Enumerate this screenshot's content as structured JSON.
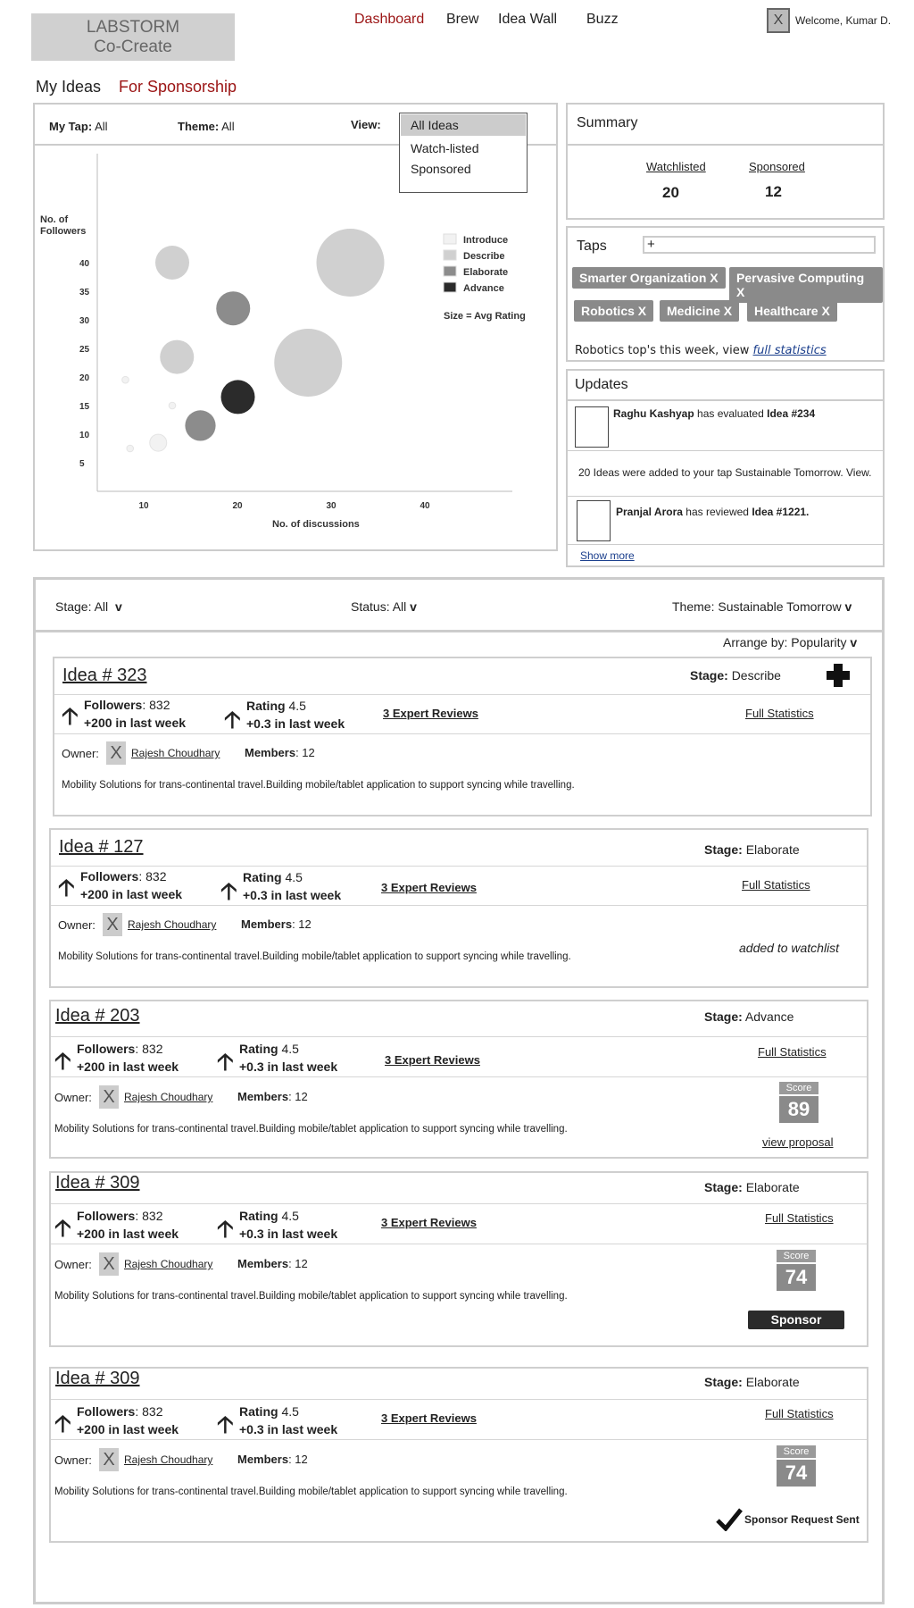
{
  "header": {
    "logo_line1": "LABSTORM",
    "logo_line2": "Co-Create",
    "nav": [
      "Dashboard",
      "Brew",
      "Idea Wall",
      "Buzz"
    ],
    "welcome": "Welcome, Kumar D.",
    "avatar_glyph": "X"
  },
  "tabs": {
    "my_ideas": "My Ideas",
    "for_sponsorship": "For Sponsorship"
  },
  "filters": {
    "my_tap_label": "My Tap:",
    "my_tap_value": "All",
    "theme_label": "Theme:",
    "theme_value": "All",
    "view_label": "View:",
    "view_options": [
      "All Ideas",
      "Watch-listed",
      "Sponsored"
    ]
  },
  "chart_data": {
    "type": "scatter",
    "ylabel": "No. of Followers",
    "xlabel": "No. of discussions",
    "x_ticks": [
      10,
      20,
      30,
      40
    ],
    "y_ticks": [
      5,
      10,
      15,
      20,
      25,
      30,
      35,
      40
    ],
    "xlim": [
      5,
      45
    ],
    "ylim": [
      0,
      50
    ],
    "size_note": "Size = Avg Rating",
    "legend": [
      {
        "name": "Introduce",
        "color": "#f2f2f2"
      },
      {
        "name": "Describe",
        "color": "#d0d0d0"
      },
      {
        "name": "Elaborate",
        "color": "#8c8c8c"
      },
      {
        "name": "Advance",
        "color": "#2b2b2b"
      }
    ],
    "points": [
      {
        "x": 13,
        "y": 40,
        "size": 2,
        "stage": "Describe"
      },
      {
        "x": 32,
        "y": 40,
        "size": 4,
        "stage": "Describe"
      },
      {
        "x": 19.5,
        "y": 32,
        "size": 2,
        "stage": "Elaborate"
      },
      {
        "x": 13.5,
        "y": 23.5,
        "size": 2,
        "stage": "Describe"
      },
      {
        "x": 27.5,
        "y": 22.5,
        "size": 4,
        "stage": "Describe"
      },
      {
        "x": 20,
        "y": 16.5,
        "size": 2,
        "stage": "Advance"
      },
      {
        "x": 16,
        "y": 11.5,
        "size": 1.8,
        "stage": "Elaborate"
      },
      {
        "x": 11.5,
        "y": 8.5,
        "size": 1,
        "stage": "Introduce"
      },
      {
        "x": 8,
        "y": 19.5,
        "size": 0.4,
        "stage": "Introduce"
      },
      {
        "x": 13,
        "y": 15,
        "size": 0.4,
        "stage": "Introduce"
      },
      {
        "x": 8.5,
        "y": 7.5,
        "size": 0.4,
        "stage": "Introduce"
      }
    ]
  },
  "summary": {
    "title": "Summary",
    "watchlisted_label": "Watchlisted",
    "watchlisted_value": "20",
    "sponsored_label": "Sponsored",
    "sponsored_value": "12"
  },
  "taps": {
    "title": "Taps",
    "add_glyph": "+",
    "chips": [
      "Smarter Organization X",
      "Pervasive Computing X",
      "Robotics X",
      "Medicine X",
      "Healthcare X"
    ],
    "footer_text": "Robotics top's this week, view",
    "footer_link": "full statistics"
  },
  "updates": {
    "title": "Updates",
    "u1_name": "Raghu Kashyap",
    "u1_mid": "has evaluated",
    "u1_idea": "Idea #234",
    "u2_text": "20 Ideas were added to your tap",
    "u2_tap": "Sustainable Tomorrow.",
    "u2_view": "View.",
    "u3_name": "Pranjal Arora",
    "u3_mid": "has reviewed",
    "u3_idea": "Idea #1221.",
    "show_more": "Show more"
  },
  "list_filters": {
    "stage": "Stage: All",
    "status": "Status: All",
    "theme": "Theme: Sustainable Tomorrow",
    "caret": "v",
    "arrange": "Arrange by: Popularity"
  },
  "ideas": [
    {
      "title": "Idea # 323",
      "stage_label": "Stage:",
      "stage": "Describe",
      "followers_label": "Followers",
      "followers": ": 832",
      "followers_delta": "+200 in last week",
      "rating_label": "Rating",
      "rating": " 4.5",
      "rating_delta": "+0.3 in last week",
      "reviews": "3 Expert Reviews",
      "stats": "Full Statistics",
      "owner_label": "Owner:",
      "owner": "Rajesh Choudhary",
      "members_label": "Members",
      "members": ": 12",
      "desc": "Mobility Solutions for trans-continental travel.Building mobile/tablet application to support syncing while travelling."
    },
    {
      "title": "Idea # 127",
      "stage_label": "Stage:",
      "stage": "Elaborate",
      "followers_label": "Followers",
      "followers": ": 832",
      "followers_delta": "+200 in last week",
      "rating_label": "Rating",
      "rating": " 4.5",
      "rating_delta": "+0.3 in last week",
      "reviews": "3 Expert Reviews",
      "stats": "Full Statistics",
      "owner_label": "Owner:",
      "owner": "Rajesh Choudhary",
      "members_label": "Members",
      "members": ": 12",
      "desc": "Mobility Solutions for trans-continental travel.Building mobile/tablet application to support syncing while travelling.",
      "note": "added to watchlist"
    },
    {
      "title": "Idea # 203",
      "stage_label": "Stage:",
      "stage": "Advance",
      "followers_label": "Followers",
      "followers": ": 832",
      "followers_delta": "+200 in last week",
      "rating_label": "Rating",
      "rating": " 4.5",
      "rating_delta": "+0.3 in last week",
      "reviews": "3 Expert Reviews",
      "stats": "Full Statistics",
      "owner_label": "Owner:",
      "owner": "Rajesh Choudhary",
      "members_label": "Members",
      "members": ": 12",
      "desc": "Mobility Solutions for trans-continental travel.Building mobile/tablet application to support syncing while travelling.",
      "score_label": "Score",
      "score": "89",
      "proposal": "view proposal"
    },
    {
      "title": "Idea # 309",
      "stage_label": "Stage:",
      "stage": "Elaborate",
      "followers_label": "Followers",
      "followers": ": 832",
      "followers_delta": "+200 in last week",
      "rating_label": "Rating",
      "rating": " 4.5",
      "rating_delta": "+0.3 in last week",
      "reviews": "3 Expert Reviews",
      "stats": "Full Statistics",
      "owner_label": "Owner:",
      "owner": "Rajesh Choudhary",
      "members_label": "Members",
      "members": ": 12",
      "desc": "Mobility Solutions for trans-continental travel.Building mobile/tablet application to support syncing while travelling.",
      "score_label": "Score",
      "score": "74",
      "sponsor": "Sponsor"
    },
    {
      "title": "Idea # 309",
      "stage_label": "Stage:",
      "stage": "Elaborate",
      "followers_label": "Followers",
      "followers": ": 832",
      "followers_delta": "+200 in last week",
      "rating_label": "Rating",
      "rating": " 4.5",
      "rating_delta": "+0.3 in last week",
      "reviews": "3 Expert Reviews",
      "stats": "Full Statistics",
      "owner_label": "Owner:",
      "owner": "Rajesh Choudhary",
      "members_label": "Members",
      "members": ": 12",
      "desc": "Mobility Solutions for trans-continental travel.Building mobile/tablet application to support syncing while travelling.",
      "score_label": "Score",
      "score": "74",
      "sent": "Sponsor Request Sent"
    }
  ],
  "icons": {
    "up_arrow": "up-arrow-icon",
    "plus": "plus-icon",
    "check": "checkmark-icon",
    "owner_avatar": "X"
  }
}
